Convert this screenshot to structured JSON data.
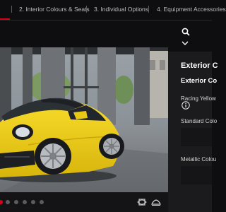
{
  "steps": [
    {
      "label": "s",
      "active": true
    },
    {
      "label": "2. Interior Colours & Seats"
    },
    {
      "label": "3. Individual Options"
    },
    {
      "label": "4. Equipment Accessories"
    }
  ],
  "panel": {
    "heading": "Exterior C",
    "subheading": "Exterior Co",
    "selected_colour": "Racing Yellow",
    "standard_label": "Standard Colo",
    "metallic_label": "Metallic Colou"
  },
  "gallery": {
    "dot_count": 6,
    "active_dot": 0
  },
  "icons": {
    "search": "search-icon",
    "collapse": "chevron-down-icon",
    "info": "info-icon",
    "view_360": "360-view-icon",
    "view_exterior": "car-view-icon"
  },
  "colors": {
    "accent": "#d5001c",
    "car": "#f2d31b",
    "panel_bg": "#1a1a1c",
    "nav_bg": "#0e0e10"
  }
}
